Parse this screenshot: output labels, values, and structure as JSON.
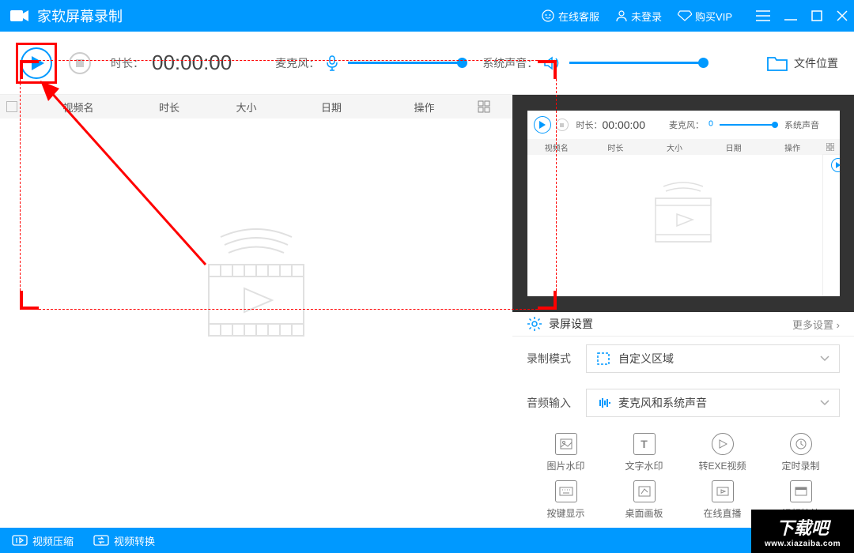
{
  "app": {
    "title": "家软屏幕录制"
  },
  "titlebar": {
    "support": "在线客服",
    "login": "未登录",
    "vip": "购买VIP"
  },
  "toolbar": {
    "duration_label": "时长：",
    "duration_value": "00:00:00",
    "mic_label": "麦克风：",
    "sys_label": "系统声音：",
    "file_location": "文件位置"
  },
  "columns": {
    "name": "视频名",
    "duration": "时长",
    "size": "大小",
    "date": "日期",
    "action": "操作"
  },
  "preview": {
    "duration_label": "时长：",
    "duration_value": "00:00:00",
    "mic_label": "麦克风：",
    "sys_label": "系统声音",
    "columns": {
      "name": "视频名",
      "duration": "时长",
      "size": "大小",
      "date": "日期",
      "action": "操作"
    }
  },
  "settings": {
    "title": "录屏设置",
    "more": "更多设置",
    "mode_label": "录制模式",
    "mode_value": "自定义区域",
    "audio_label": "音频输入",
    "audio_value": "麦克风和系统声音"
  },
  "options": {
    "img_watermark": "图片水印",
    "text_watermark": "文字水印",
    "exe_video": "转EXE视频",
    "timed_rec": "定时录制",
    "key_display": "按键显示",
    "desktop_board": "桌面画板",
    "live_stream": "在线直播",
    "video_fx": "视频特效"
  },
  "bottombar": {
    "compress": "视频压缩",
    "convert": "视频转换"
  },
  "watermark": {
    "line1": "下载吧",
    "line2": "www.xiazaiba.com"
  }
}
